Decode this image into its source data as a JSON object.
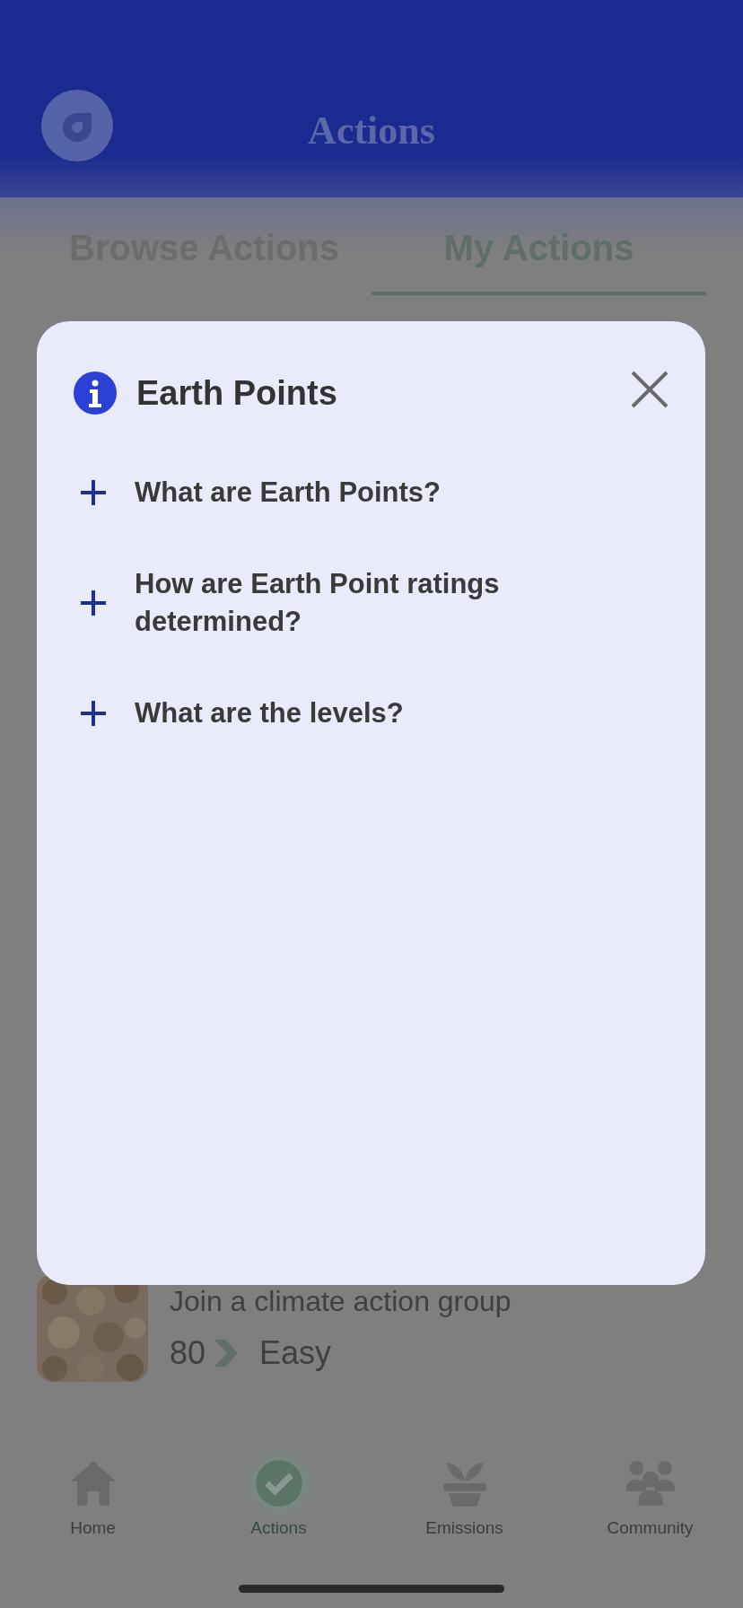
{
  "header": {
    "title": "Actions"
  },
  "tabs": [
    {
      "label": "Browse Actions",
      "selected": false
    },
    {
      "label": "My Actions",
      "selected": true
    }
  ],
  "action": {
    "title": "Join a climate action group",
    "points": "80",
    "difficulty": "Easy"
  },
  "nav": [
    {
      "label": "Home",
      "selected": false
    },
    {
      "label": "Actions",
      "selected": true
    },
    {
      "label": "Emissions",
      "selected": false
    },
    {
      "label": "Community",
      "selected": false
    }
  ],
  "modal": {
    "title": "Earth Points",
    "items": [
      {
        "label": "What are Earth Points?",
        "expanded": false
      },
      {
        "label": "How are Earth Point ratings determined?",
        "expanded": false
      },
      {
        "label": "What are the levels?",
        "expanded": false
      }
    ]
  }
}
